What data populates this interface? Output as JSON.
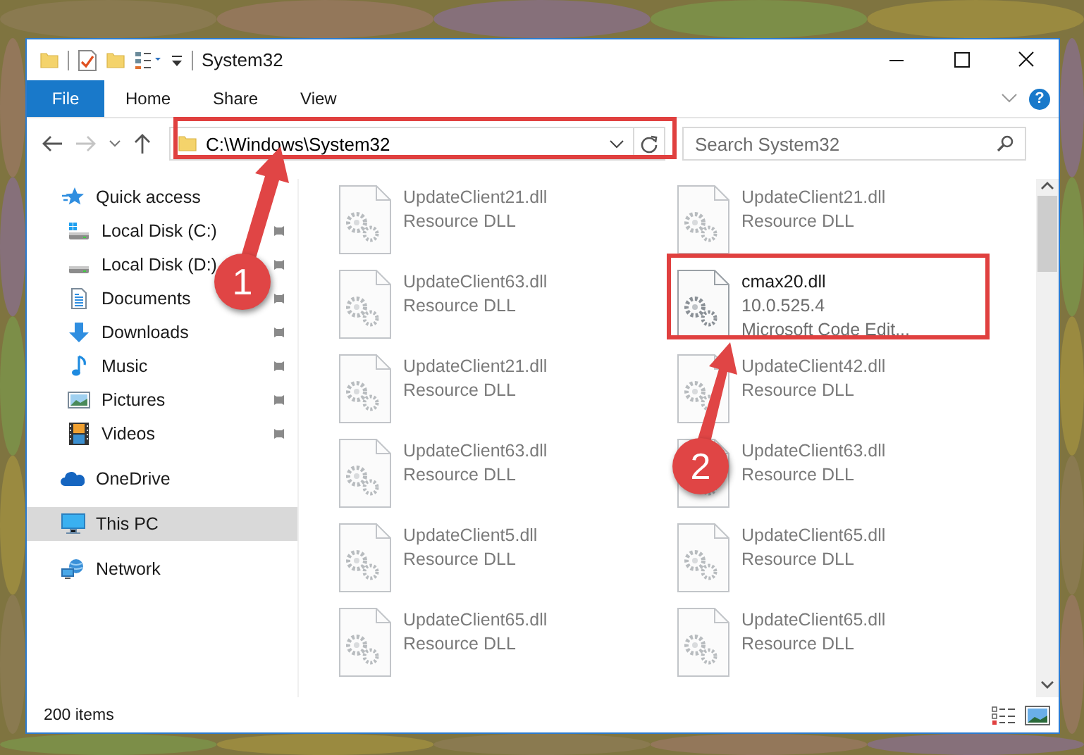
{
  "window": {
    "title": "System32"
  },
  "ribbon": {
    "tabs": [
      {
        "label": "File",
        "selected": true
      },
      {
        "label": "Home",
        "selected": false
      },
      {
        "label": "Share",
        "selected": false
      },
      {
        "label": "View",
        "selected": false
      }
    ],
    "help": "?"
  },
  "address_bar": {
    "path": "C:\\Windows\\System32"
  },
  "search": {
    "placeholder": "Search System32"
  },
  "sidebar": {
    "items": [
      {
        "label": "Quick access",
        "kind": "star",
        "selected": false,
        "children": [
          {
            "label": "Local Disk (C:)",
            "kind": "system-drive",
            "pinned": true,
            "selected": false
          },
          {
            "label": "Local Disk (D:)",
            "kind": "drive",
            "pinned": true,
            "selected": false
          },
          {
            "label": "Documents",
            "kind": "documents",
            "pinned": true,
            "selected": false
          },
          {
            "label": "Downloads",
            "kind": "downloads",
            "pinned": true,
            "selected": false
          },
          {
            "label": "Music",
            "kind": "music",
            "pinned": true,
            "selected": false
          },
          {
            "label": "Pictures",
            "kind": "pictures",
            "pinned": true,
            "selected": false
          },
          {
            "label": "Videos",
            "kind": "videos",
            "pinned": true,
            "selected": false
          }
        ]
      },
      {
        "label": "OneDrive",
        "kind": "cloud",
        "selected": false
      },
      {
        "label": "This PC",
        "kind": "computer",
        "selected": true
      },
      {
        "label": "Network",
        "kind": "network",
        "selected": false
      }
    ]
  },
  "files": [
    {
      "name": "UpdateClient21.dll",
      "details": [
        "Resource DLL"
      ],
      "blurred": true
    },
    {
      "name": "UpdateClient21.dll",
      "details": [
        "Resource DLL"
      ],
      "blurred": true
    },
    {
      "name": "UpdateClient63.dll",
      "details": [
        "Resource DLL"
      ],
      "blurred": true
    },
    {
      "name": "cmax20.dll",
      "details": [
        "10.0.525.4",
        "Microsoft Code Edit..."
      ],
      "blurred": false
    },
    {
      "name": "UpdateClient21.dll",
      "details": [
        "Resource DLL"
      ],
      "blurred": true
    },
    {
      "name": "UpdateClient42.dll",
      "details": [
        "Resource DLL"
      ],
      "blurred": true
    },
    {
      "name": "UpdateClient63.dll",
      "details": [
        "Resource DLL"
      ],
      "blurred": true
    },
    {
      "name": "UpdateClient63.dll",
      "details": [
        "Resource DLL"
      ],
      "blurred": true
    },
    {
      "name": "UpdateClient5.dll",
      "details": [
        "Resource DLL"
      ],
      "blurred": true
    },
    {
      "name": "UpdateClient65.dll",
      "details": [
        "Resource DLL"
      ],
      "blurred": true
    },
    {
      "name": "UpdateClient65.dll",
      "details": [
        "Resource DLL"
      ],
      "blurred": true
    },
    {
      "name": "UpdateClient65.dll",
      "details": [
        "Resource DLL"
      ],
      "blurred": true
    }
  ],
  "status_bar": {
    "item_count": "200 items"
  },
  "annotations": [
    {
      "label": "1"
    },
    {
      "label": "2"
    }
  ]
}
